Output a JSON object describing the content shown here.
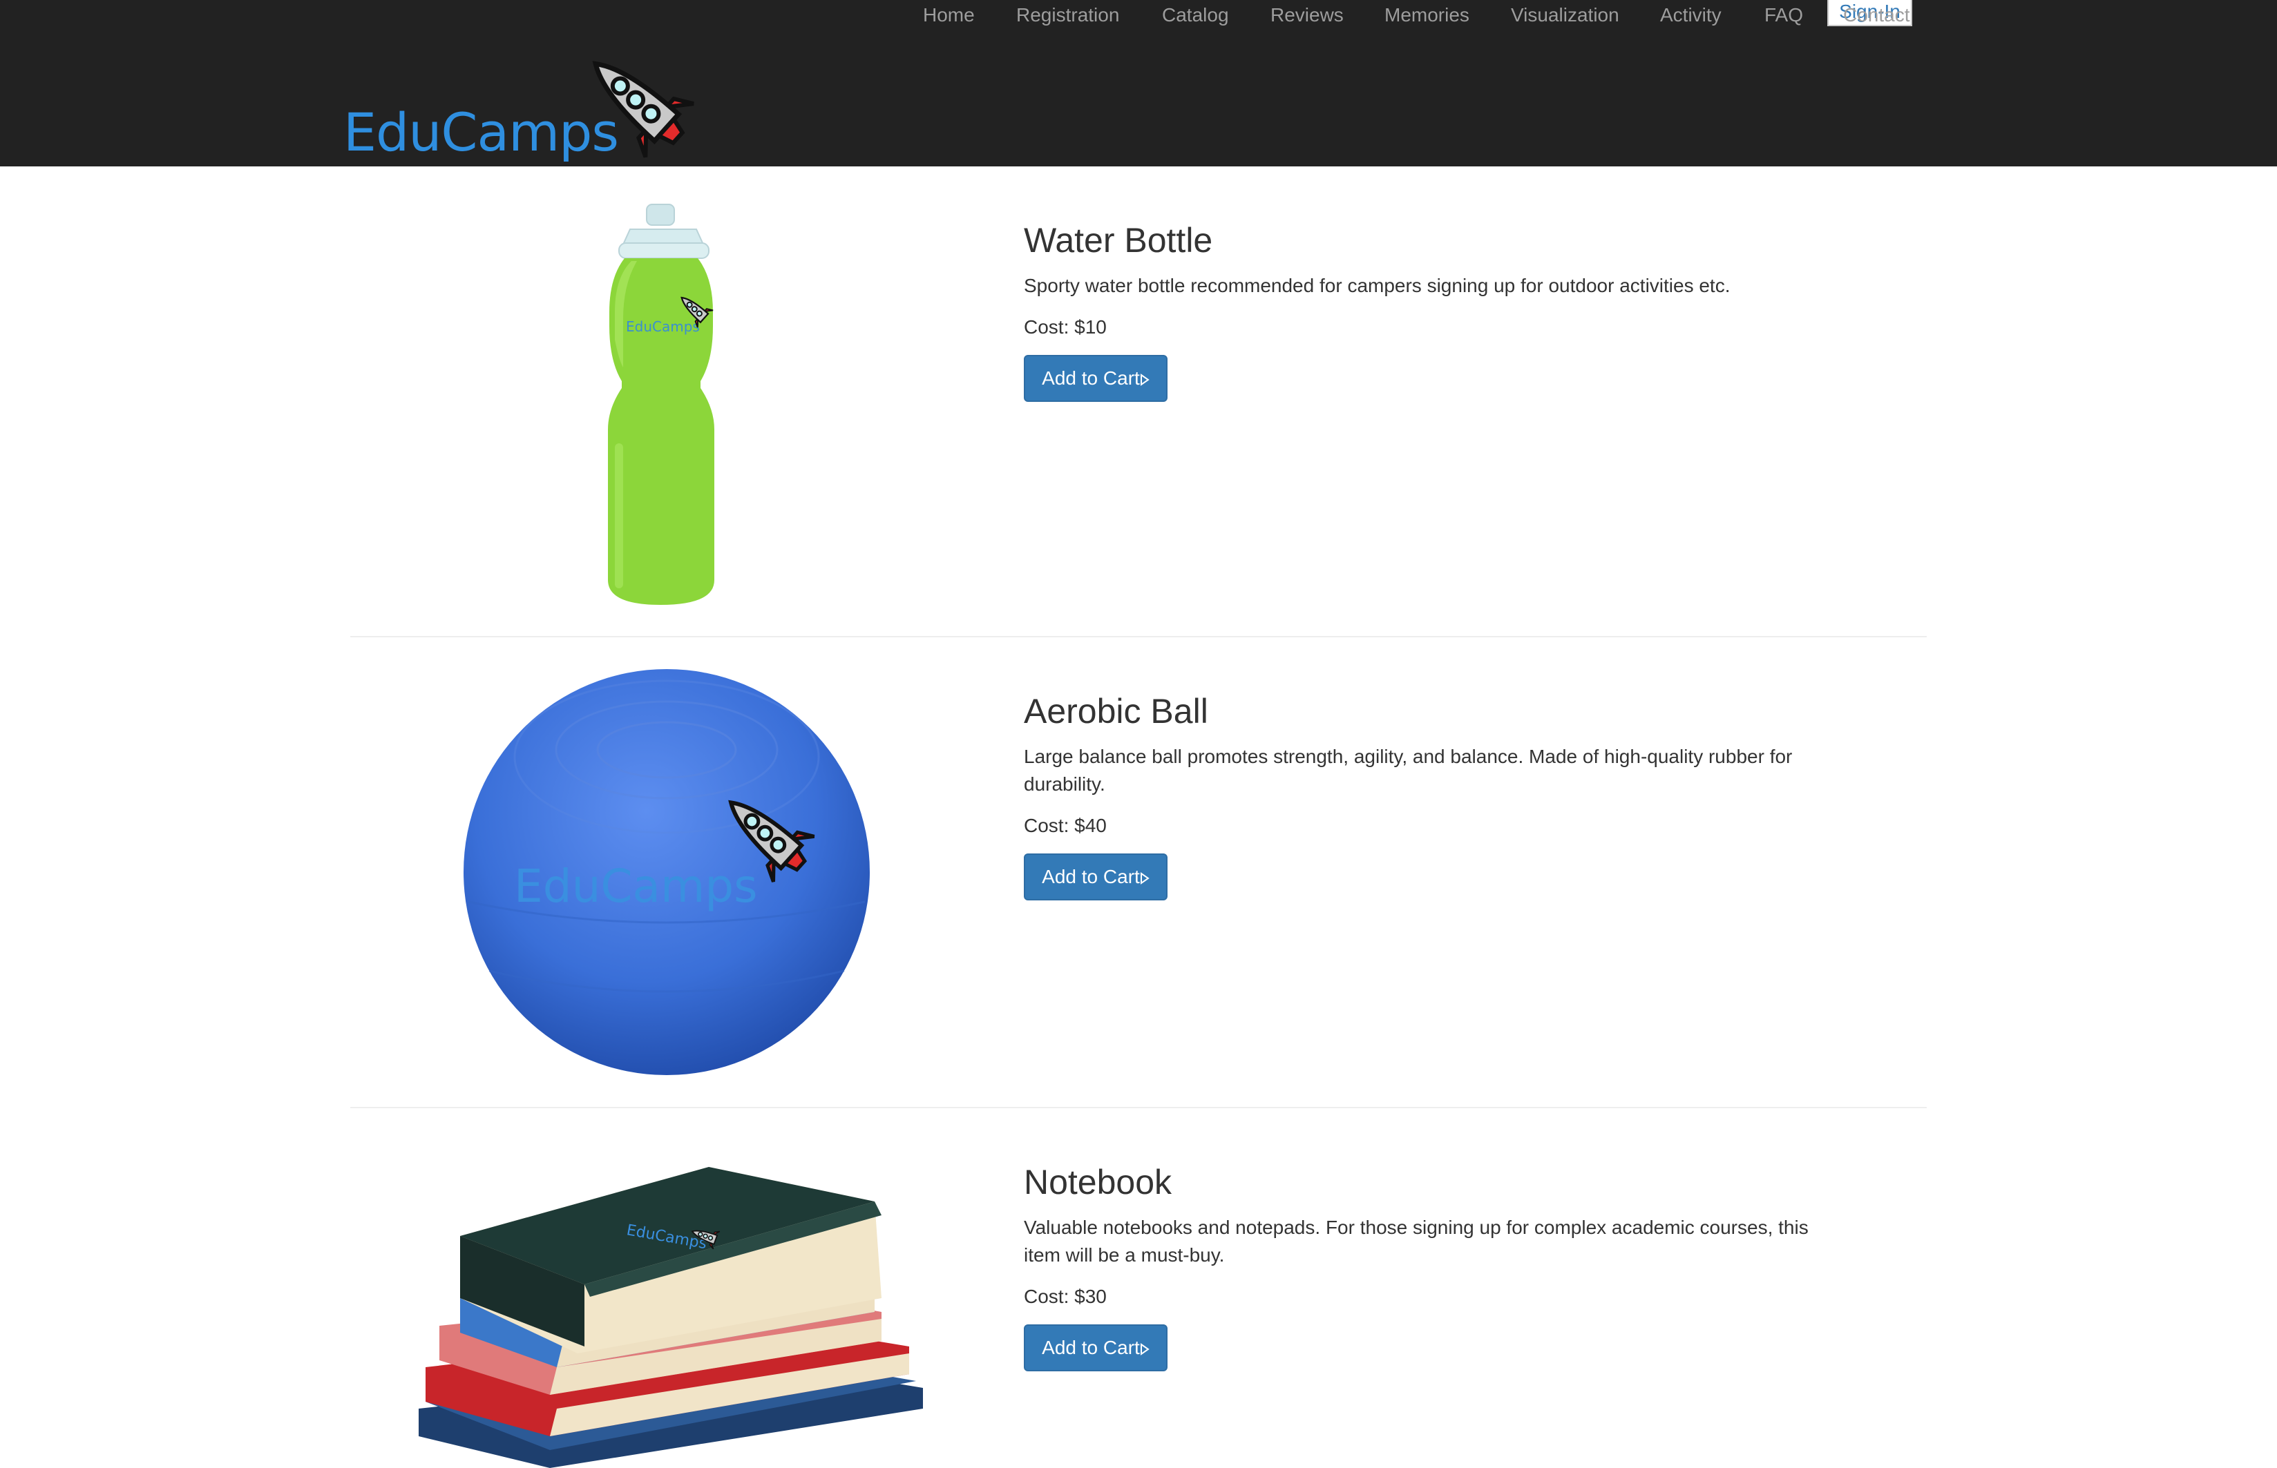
{
  "header": {
    "brand": "EduCamps",
    "signin_label": "Sign-In",
    "nav": [
      "Home",
      "Registration",
      "Catalog",
      "Reviews",
      "Memories",
      "Visualization",
      "Activity",
      "FAQ",
      "Contact"
    ]
  },
  "products": [
    {
      "title": "Water Bottle",
      "description": "Sporty water bottle recommended for campers signing up for outdoor activities etc.",
      "cost": "Cost: $10",
      "button": "Add to Cart",
      "image_logo": "EduCamps"
    },
    {
      "title": "Aerobic Ball",
      "description": "Large balance ball promotes strength, agility, and balance. Made of high-quality rubber for durability.",
      "cost": "Cost: $40",
      "button": "Add to Cart",
      "image_logo": "EduCamps"
    },
    {
      "title": "Notebook",
      "description": "Valuable notebooks and notepads. For those signing up for complex academic courses, this item will be a must-buy.",
      "cost": "Cost: $30",
      "button": "Add to Cart",
      "image_logo": "EduCamps"
    }
  ],
  "colors": {
    "navbar_bg": "#222222",
    "nav_link": "#9d9d9d",
    "brand_blue": "#2f8fe0",
    "button_bg": "#337ab7",
    "bottle_green": "#8cd63a",
    "ball_blue": "#3a6fd8"
  }
}
